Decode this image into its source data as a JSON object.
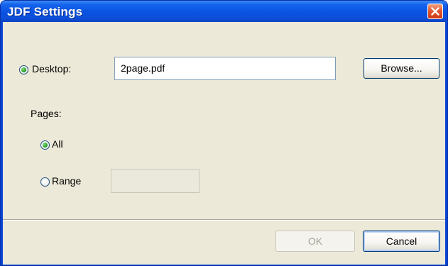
{
  "window": {
    "title": "JDF Settings",
    "close_icon": "close-icon",
    "colors": {
      "titlebar": "#0a52e2",
      "close": "#e3572f",
      "face": "#ece9d8"
    }
  },
  "desktop": {
    "label": "Desktop:",
    "selected": true,
    "file_value": "2page.pdf",
    "browse_label": "Browse..."
  },
  "pages": {
    "heading": "Pages:",
    "options": [
      {
        "label": "All",
        "selected": true
      },
      {
        "label": "Range",
        "selected": false
      }
    ],
    "range_value": ""
  },
  "buttons": {
    "ok_label": "OK",
    "ok_enabled": false,
    "cancel_label": "Cancel"
  }
}
